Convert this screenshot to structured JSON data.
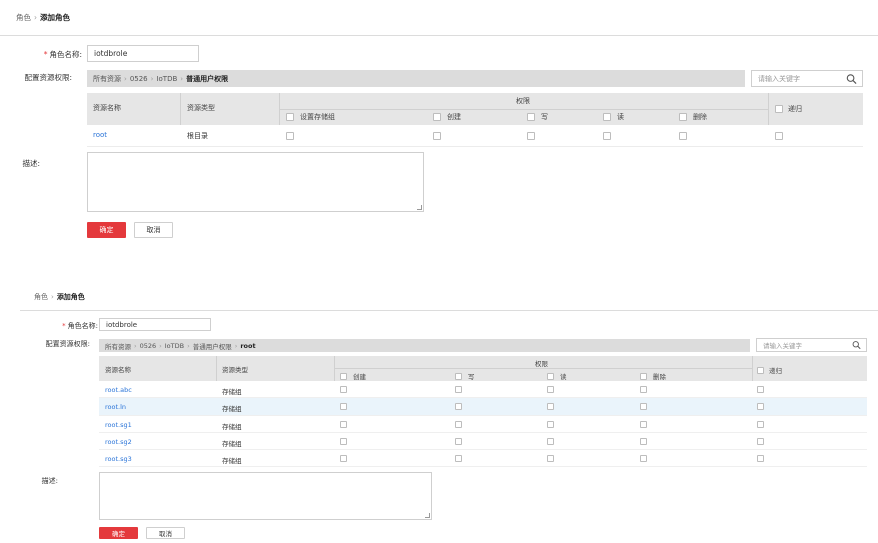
{
  "top": {
    "breadcrumb": {
      "parent": "角色",
      "current": "添加角色"
    },
    "role_label": "角色名称:",
    "role_value": "iotdbrole",
    "perm_label": "配置资源权限:",
    "path": {
      "p1": "所有资源",
      "p2": "0526",
      "p3": "IoTDB",
      "p4": "普通用户权限"
    },
    "search_placeholder": "请输入关键字",
    "table": {
      "col_name": "资源名称",
      "col_type": "资源类型",
      "col_perm": "权限",
      "col_recursive": "递归",
      "perms": [
        "设置存储组",
        "创建",
        "写",
        "读",
        "删除"
      ],
      "rows": [
        {
          "name": "root",
          "type": "根目录"
        }
      ]
    },
    "desc_label": "描述:",
    "ok": "确定",
    "cancel": "取消"
  },
  "bottom": {
    "breadcrumb": {
      "parent": "角色",
      "current": "添加角色"
    },
    "role_label": "角色名称:",
    "role_value": "iotdbrole",
    "perm_label": "配置资源权限:",
    "path": {
      "p1": "所有资源",
      "p2": "0526",
      "p3": "IoTDB",
      "p4": "普通用户权限",
      "p5": "root"
    },
    "search_placeholder": "请输入关键字",
    "table": {
      "col_name": "资源名称",
      "col_type": "资源类型",
      "col_perm": "权限",
      "col_recursive": "递归",
      "perms": [
        "创建",
        "写",
        "读",
        "删除"
      ],
      "rows": [
        {
          "name": "root.abc",
          "type": "存储组"
        },
        {
          "name": "root.ln",
          "type": "存储组"
        },
        {
          "name": "root.sg1",
          "type": "存储组"
        },
        {
          "name": "root.sg2",
          "type": "存储组"
        },
        {
          "name": "root.sg3",
          "type": "存储组"
        }
      ]
    },
    "desc_label": "描述:",
    "ok": "确定",
    "cancel": "取消"
  },
  "colors": {
    "accent": "#e4393c",
    "link": "#2a74d8",
    "header_bg": "#e6e6e6",
    "highlight_row": "#eaf4fb"
  }
}
